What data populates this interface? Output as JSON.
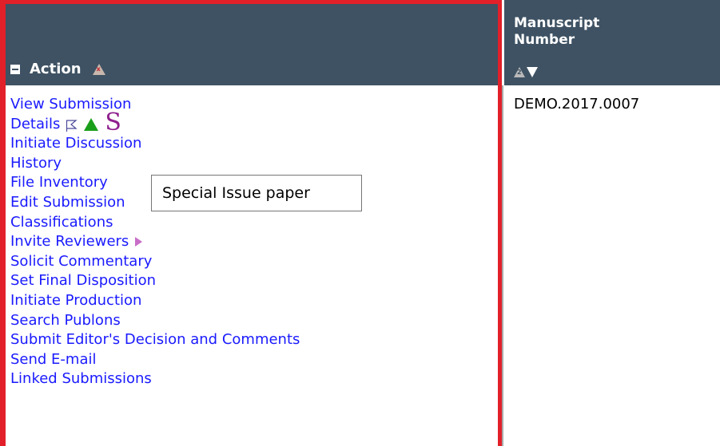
{
  "table": {
    "headers": {
      "action": "Action",
      "manuscript_number_line1": "Manuscript",
      "manuscript_number_line2": "Number",
      "sort_index": "2"
    },
    "action_links": [
      "View Submission",
      "Details",
      "Initiate Discussion",
      "History",
      "File Inventory",
      "Edit Submission",
      "Classifications",
      "Invite Reviewers",
      "Solicit Commentary",
      "Set Final Disposition",
      "Initiate Production",
      "Search Publons",
      "Submit Editor's Decision and Comments",
      "Send E-mail",
      "Linked Submissions"
    ],
    "special_issue_marker": "S",
    "manuscript_number": "DEMO.2017.0007"
  },
  "tooltip": {
    "text": "Special Issue paper"
  },
  "colors": {
    "header_bg": "#3e5263",
    "link": "#1a1aff",
    "highlight_border": "#e2202a",
    "flag_green": "#1a9e1a",
    "special_purple": "#8e1f8e"
  },
  "icons": {
    "collapse": "collapse-icon",
    "sort_remove": "sort-remove-icon",
    "sort_ascending": "sort-ascending-icon",
    "sort_descending": "sort-descending-icon",
    "flag": "flag-icon",
    "green_triangle": "green-triangle-icon",
    "invite_arrow": "play-arrow-icon"
  }
}
